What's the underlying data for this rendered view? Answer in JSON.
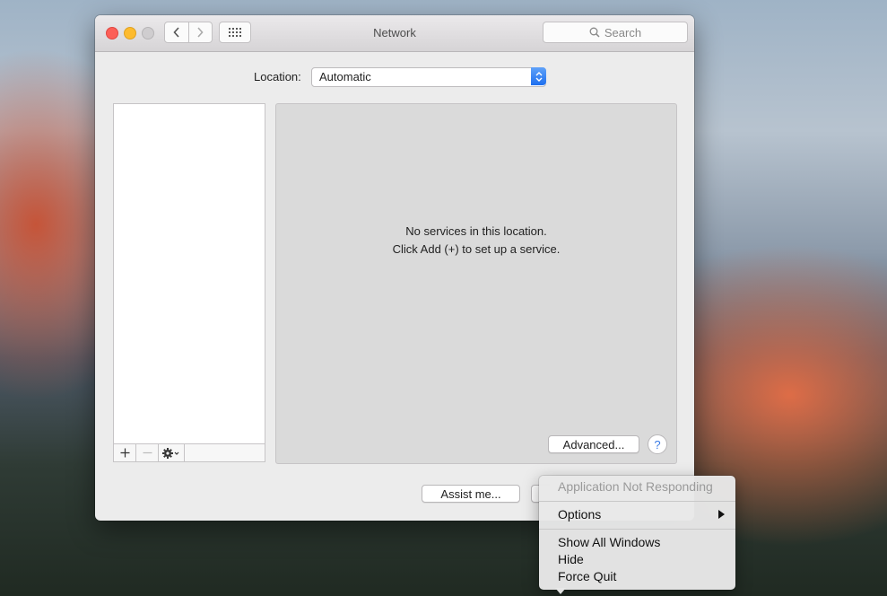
{
  "window": {
    "title": "Network",
    "search_placeholder": "Search"
  },
  "location": {
    "label": "Location:",
    "value": "Automatic"
  },
  "detail": {
    "message_line1": "No services in this location.",
    "message_line2": "Click Add (+) to set up a service.",
    "advanced_label": "Advanced...",
    "help_label": "?"
  },
  "bottom": {
    "assist_label": "Assist me..."
  },
  "context_menu": {
    "header": "Application Not Responding",
    "options": "Options",
    "show_all_windows": "Show All Windows",
    "hide": "Hide",
    "force_quit": "Force Quit"
  },
  "colors": {
    "close": "#fc5f57",
    "minimize": "#fdbb2e",
    "accent": "#1e6fef"
  },
  "icons": [
    "back-icon",
    "forward-icon",
    "grid-icon",
    "search-icon",
    "chevrons-icon",
    "add-icon",
    "remove-icon",
    "gear-icon",
    "submenu-arrow-icon"
  ]
}
